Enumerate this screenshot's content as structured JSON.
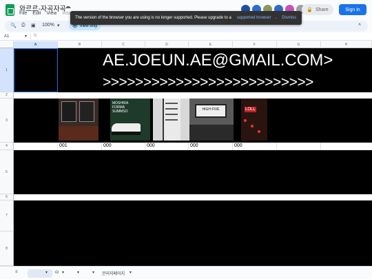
{
  "app": {
    "doc_title": "와르르-자곡자곡",
    "menu": [
      "File",
      "Edit",
      "View",
      "Insert"
    ],
    "share_label": "Share",
    "signin_label": "Sign in"
  },
  "toast": {
    "message": "The version of the browser you are using is no longer supported. Please upgrade to a",
    "link": "supported browser",
    "dot": ".",
    "dismiss": "Dismiss"
  },
  "toolbar": {
    "zoom": "100%",
    "view_only": "View only"
  },
  "formula_bar": {
    "cell_ref": "A1",
    "fx": "fx"
  },
  "columns": [
    "A",
    "B",
    "C",
    "D",
    "E",
    "F",
    "G",
    "H"
  ],
  "rows": [
    "1",
    "2",
    "3",
    "4",
    "5",
    "6",
    "7",
    "8"
  ],
  "cells": {
    "r1_line1": "AE.JOEUN.AE@GMAIL.COM>",
    "r1_line2": ">>>>>>>>>>>>>>>>>>>>>>>>>>",
    "r4": [
      "001",
      "000",
      "000",
      "000",
      "000"
    ]
  },
  "photos": [
    {
      "name": "wall-posters-photo",
      "bg": "#3a2a24"
    },
    {
      "name": "sneaker-poster-photo",
      "bg": "#1e3a2a",
      "caption": "MOSHIRA FORMA SUMMSO"
    },
    {
      "name": "tall-poster-photo",
      "bg": "#d8d8d8"
    },
    {
      "name": "signboard-photo",
      "bg": "#5a5a5a",
      "caption": "HIGH FIVE"
    },
    {
      "name": "red-lamp-photo",
      "bg": "#2a1410",
      "caption": "LOLL"
    }
  ],
  "sheet_tab": "관리자페이지",
  "colors": {
    "accent": "#1a73e8",
    "sheets_green": "#0f9d58",
    "banner_black": "#000000"
  }
}
